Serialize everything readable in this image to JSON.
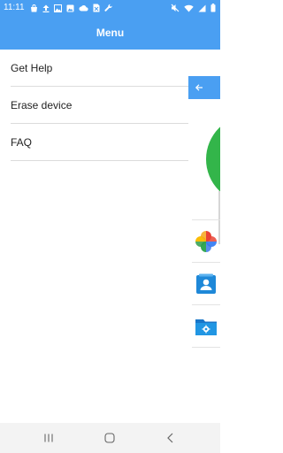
{
  "status_bar": {
    "time": "11:11",
    "left_icons": [
      "bag-icon",
      "upload-icon",
      "image-icon",
      "gallery-icon",
      "cloud-icon",
      "sim-icon",
      "wrench-icon"
    ],
    "right_icons": [
      "mute-icon",
      "wifi-icon",
      "signal-icon",
      "battery-icon"
    ]
  },
  "app_bar": {
    "title": "Menu"
  },
  "menu": {
    "items": [
      {
        "label": "Get Help"
      },
      {
        "label": "Erase device"
      },
      {
        "label": "FAQ"
      }
    ]
  },
  "background_app": {
    "icons": [
      "pinwheel-icon",
      "contact-icon",
      "folder-icon"
    ]
  },
  "colors": {
    "accent": "#4a9ff2",
    "green": "#33b54a"
  },
  "nav_bar": {
    "buttons": [
      "recents-icon",
      "home-icon",
      "back-icon"
    ]
  }
}
